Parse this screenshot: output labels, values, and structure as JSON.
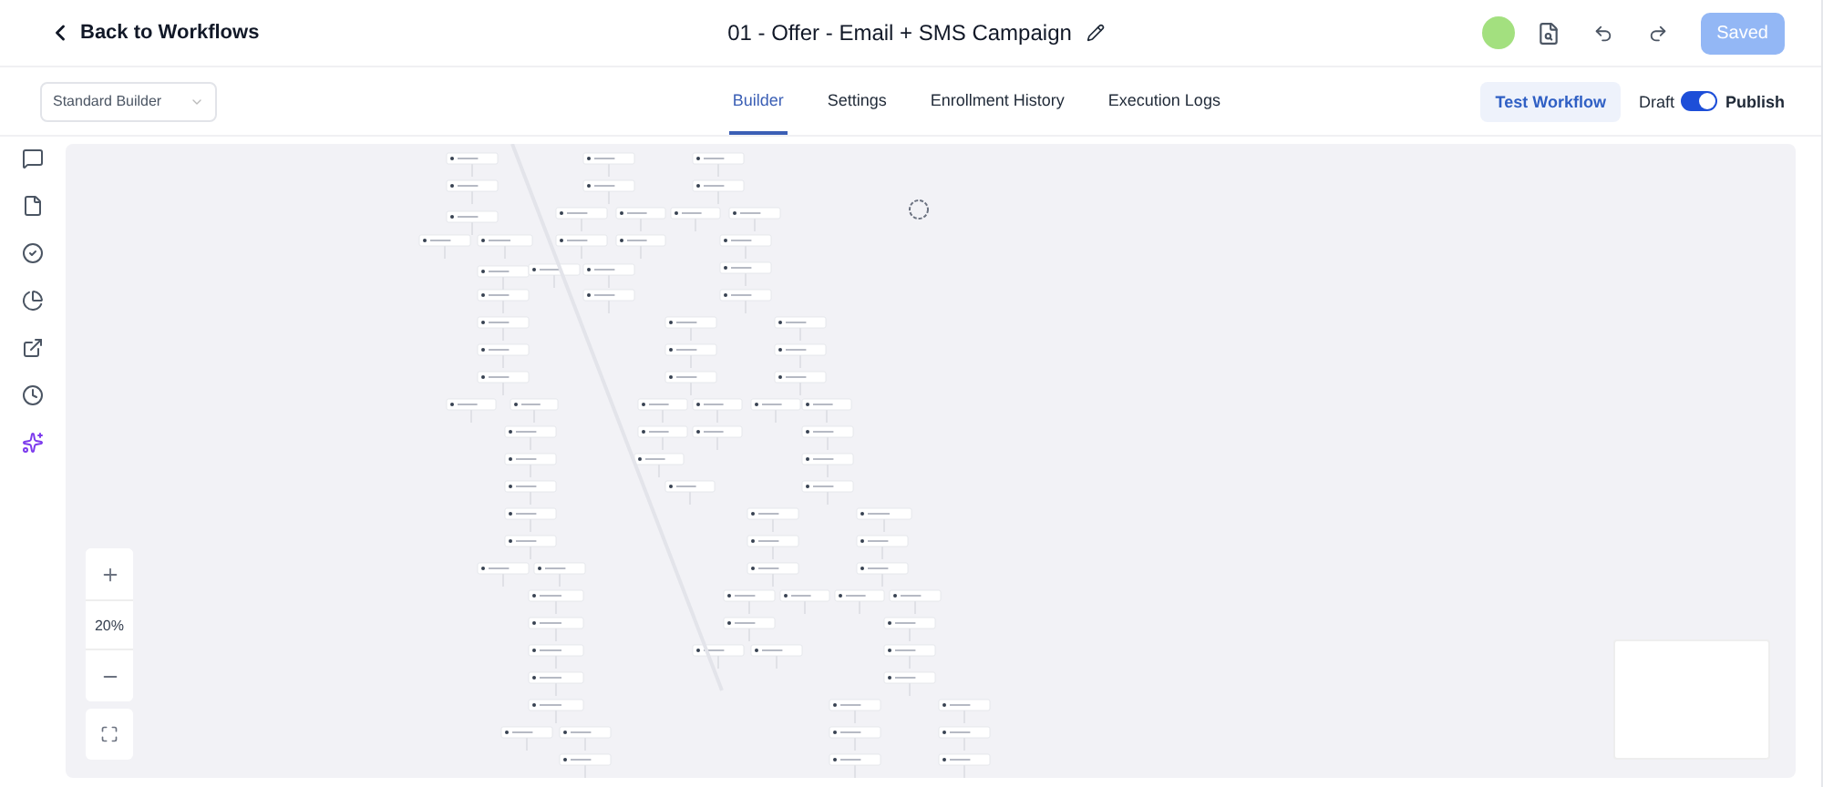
{
  "header": {
    "back_link": "Back to Workflows",
    "title": "01 - Offer - Email + SMS Campaign",
    "saved_button": "Saved"
  },
  "builder_select": {
    "value": "Standard Builder"
  },
  "tabs": [
    {
      "label": "Builder",
      "selected": true
    },
    {
      "label": "Settings",
      "selected": false
    },
    {
      "label": "Enrollment History",
      "selected": false
    },
    {
      "label": "Execution Logs",
      "selected": false
    }
  ],
  "test_button": "Test Workflow",
  "publish_toggle": {
    "off_label": "Draft",
    "on_label": "Publish",
    "on": true
  },
  "zoom_controls": {
    "level": "20%"
  }
}
